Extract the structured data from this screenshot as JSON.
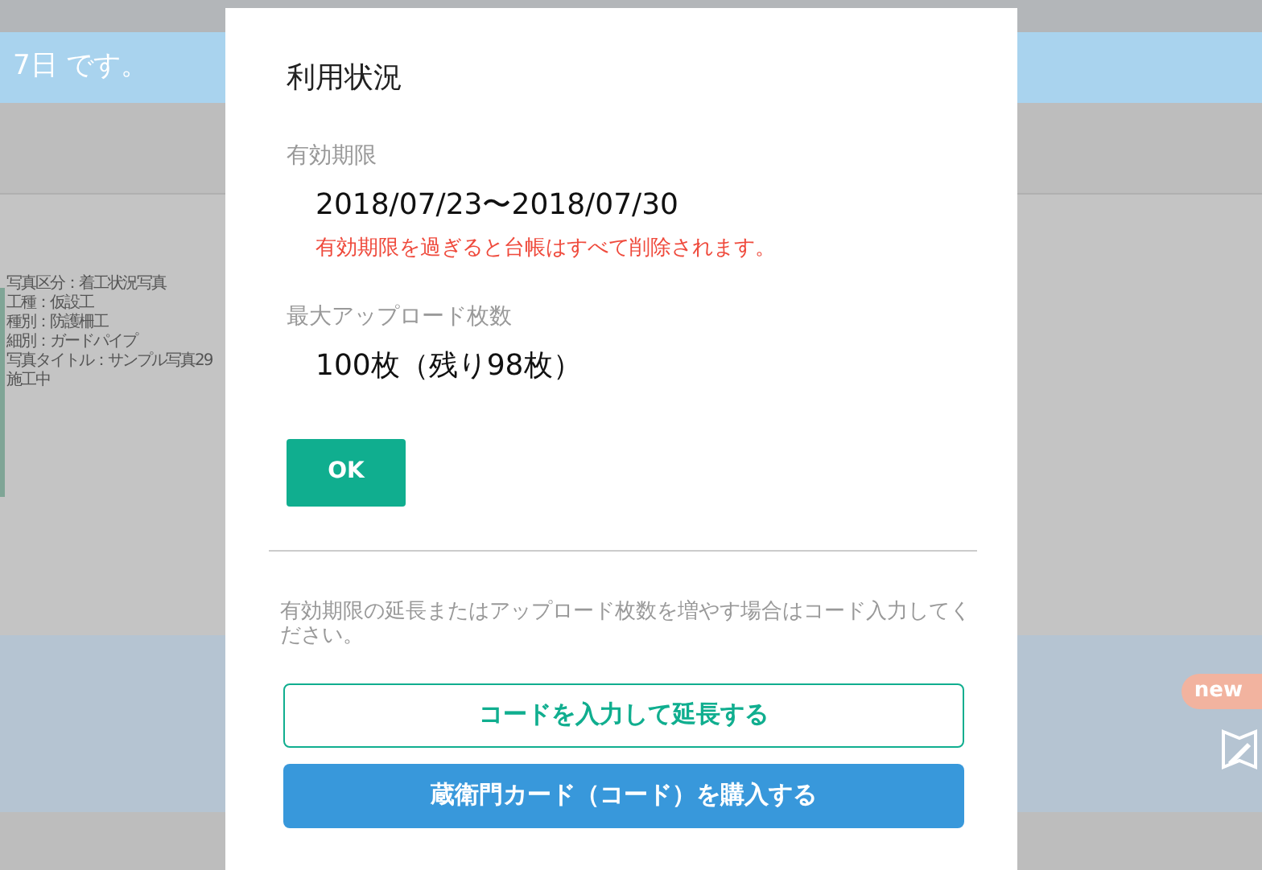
{
  "background": {
    "banner_text": "7日 です。",
    "photo_info": [
      "写真区分：着工状況写真",
      "工種：仮設工",
      "種別：防護柵工",
      "細別：ガードパイプ",
      "写真タイトル：サンプル写真29",
      "施工中"
    ],
    "new_badge": "new"
  },
  "dialog": {
    "title": "利用状況",
    "fields": [
      {
        "label": "有効期限",
        "value": "2018/07/23〜2018/07/30",
        "warning": "有効期限を過ぎると台帳はすべて削除されます。"
      },
      {
        "label": "最大アップロード枚数",
        "value": "100枚（残り98枚）"
      }
    ],
    "ok_button": "OK",
    "info": "有効期限の延長またはアップロード枚数を増やす場合はコード入力してください。",
    "buttons": [
      {
        "kind": "outline",
        "label": "コードを入力して延長する"
      },
      {
        "kind": "solid",
        "label": "蔵衛門カード（コード）を購入する"
      }
    ]
  }
}
